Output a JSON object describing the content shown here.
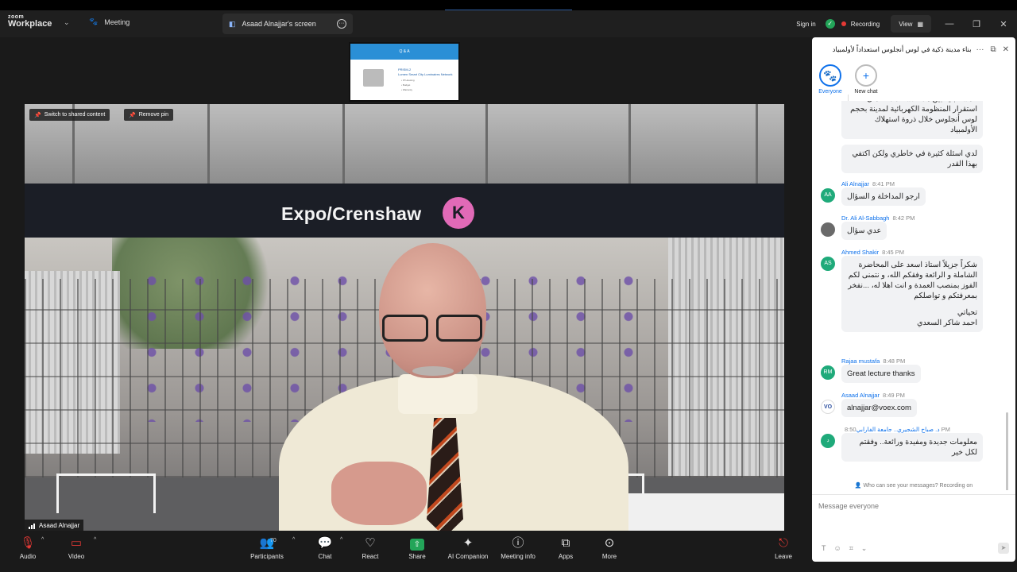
{
  "titlebar": {
    "brand_top": "zoom",
    "brand_main": "Workplace",
    "meeting_label": "Meeting",
    "share_tab_label": "Asaad Alnajjar's screen",
    "sign_in": "Sign in",
    "recording": "Recording",
    "view": "View"
  },
  "thumbnail": {
    "header": "Q & A",
    "title1": "PRISM-2",
    "title2": "Lumen Smart City Luminaires Network",
    "items": [
      "• IP Housing",
      "• Budget",
      "• Warranty"
    ]
  },
  "video": {
    "switch_btn": "Switch to shared content",
    "remove_pin": "Remove pin",
    "sign_text": "Expo/Crenshaw",
    "sign_letter": "K",
    "participant_name": "Asaad Alnajjar"
  },
  "toolbar": {
    "audio": "Audio",
    "video": "Video",
    "participants": "Participants",
    "participants_count": "70",
    "chat": "Chat",
    "react": "React",
    "share": "Share",
    "ai_companion": "AI Companion",
    "meeting_info": "Meeting info",
    "apps": "Apps",
    "more": "More",
    "leave": "Leave"
  },
  "chat": {
    "title": "بناء مدينة ذكية في لوس أنجلوس استعداداً لأولمبياد",
    "tabs": [
      {
        "label": "Everyone"
      },
      {
        "label": "New chat"
      }
    ],
    "partial1": "المستقبلية بين هذا الاستعداد لضمان استقرار المنظومة الكهربائية لمدينة بحجم لوس أنجلوس خلال ذروة استهلاك الأولمبياد",
    "partial2": "لدي اسئلة كثيرة في خاطري ولكن اكتفي بهذا القدر",
    "messages": [
      {
        "sender": "Ali Alnajjar",
        "time": "8:41 PM",
        "initials": "AA",
        "text": "ارجو المداخلة و السؤال"
      },
      {
        "sender": "Dr. Ali Al-Sabbagh",
        "time": "8:42 PM",
        "initials": "",
        "text": "عدي سؤال"
      },
      {
        "sender": "Ahmed Shakir",
        "time": "8:45 PM",
        "initials": "AS",
        "text": "شكراً جزيلاً استاذ اسعد على المحاضرة الشاملة و الرائعة وفقكم الله، و نتمنى لكم الفوز بمنصب العمدة و انت اهلا له، ...نفخر بمعرفتكم و تواصلكم",
        "text2": "تحياتي",
        "text3": "احمد شاكر السعدي"
      },
      {
        "sender": "Rajaa mustafa",
        "time": "8:48 PM",
        "initials": "RM",
        "text": "Great lecture  thanks"
      },
      {
        "sender": "Asaad Alnajjar",
        "time": "8:49 PM",
        "initials": "VO",
        "text": "alnajjar@voex.com"
      },
      {
        "sender": "د. صباح الشجيري.. جامعة الفارابي",
        "time": "8:50 PM",
        "initials": "د",
        "text": "معلومات جديدة ومفيدة  ورائعة.. وفقتم لكل خير"
      }
    ],
    "privacy": "Who can see your messages? Recording on",
    "compose_placeholder": "Message everyone"
  },
  "colors": {
    "accent": "#0e71eb",
    "recording": "#e53935",
    "shield": "#23a559",
    "share_green": "#23a559"
  }
}
